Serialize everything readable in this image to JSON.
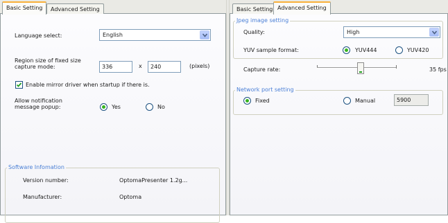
{
  "left": {
    "tabs": [
      {
        "label": "Basic Setting",
        "active": true
      },
      {
        "label": "Advanced Setting",
        "active": false
      }
    ],
    "language": {
      "label": "Language select:",
      "value": "English"
    },
    "region": {
      "label_line1": "Region size of fixed size",
      "label_line2": "capture mode:",
      "width": "336",
      "times": "x",
      "height": "240",
      "unit": "(pixels)"
    },
    "mirror_driver": {
      "label": "Enable mirror driver when startup if there is.",
      "checked": true
    },
    "notification": {
      "label_line1": "Allow notification",
      "label_line2": "message popup:",
      "yes": "Yes",
      "no": "No",
      "selected": "yes"
    },
    "software_info": {
      "title": "Software Infomation",
      "version_label": "Version number:",
      "version_value": "OptomaPresenter 1.2g...",
      "manufacturer_label": "Manufacturer:",
      "manufacturer_value": "Optoma"
    }
  },
  "right": {
    "tabs": [
      {
        "label": "Basic Setting",
        "active": false
      },
      {
        "label": "Advanced Setting",
        "active": true
      }
    ],
    "jpeg": {
      "title": "Jpeg image setting",
      "quality_label": "Quality:",
      "quality_value": "High",
      "yuv_label": "YUV sample format:",
      "yuv444": "YUV444",
      "yuv420": "YUV420",
      "selected": "yuv444"
    },
    "capture_rate": {
      "label": "Capture rate:",
      "value": "35 fps",
      "level": 0.55
    },
    "network": {
      "title": "Network port setting",
      "fixed": "Fixed",
      "manual": "Manual",
      "port": "5900",
      "selected": "fixed"
    }
  },
  "colors": {
    "accent_tab": "#f9b03a",
    "group_title": "#4a7fd6",
    "radio_dot": "#35b41f"
  }
}
